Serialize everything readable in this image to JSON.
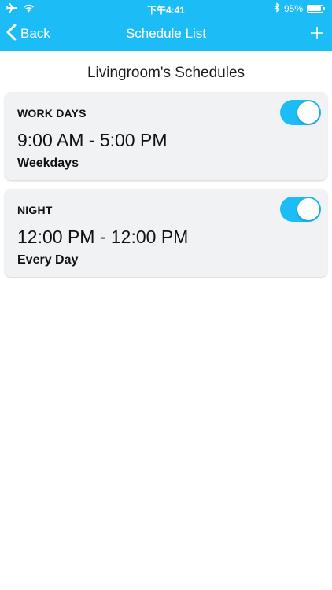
{
  "status_bar": {
    "time": "下午4:41",
    "battery": "95%",
    "battery_level": 0.95
  },
  "nav": {
    "back_label": "Back",
    "title": "Schedule List"
  },
  "page": {
    "section_title": "Livingroom's Schedules"
  },
  "schedules": [
    {
      "name": "WORK DAYS",
      "time": "9:00 AM - 5:00 PM",
      "days": "Weekdays",
      "enabled": true
    },
    {
      "name": "NIGHT",
      "time": "12:00 PM - 12:00 PM",
      "days": "Every Day",
      "enabled": true
    }
  ],
  "colors": {
    "accent": "#1cbcf6",
    "card_bg": "#f0f2f3",
    "text": "#111111"
  },
  "icons": {
    "airplane": "airplane-icon",
    "wifi": "wifi-icon",
    "bluetooth": "bluetooth-icon",
    "battery": "battery-icon",
    "back": "chevron-left-icon",
    "add": "plus-icon"
  }
}
